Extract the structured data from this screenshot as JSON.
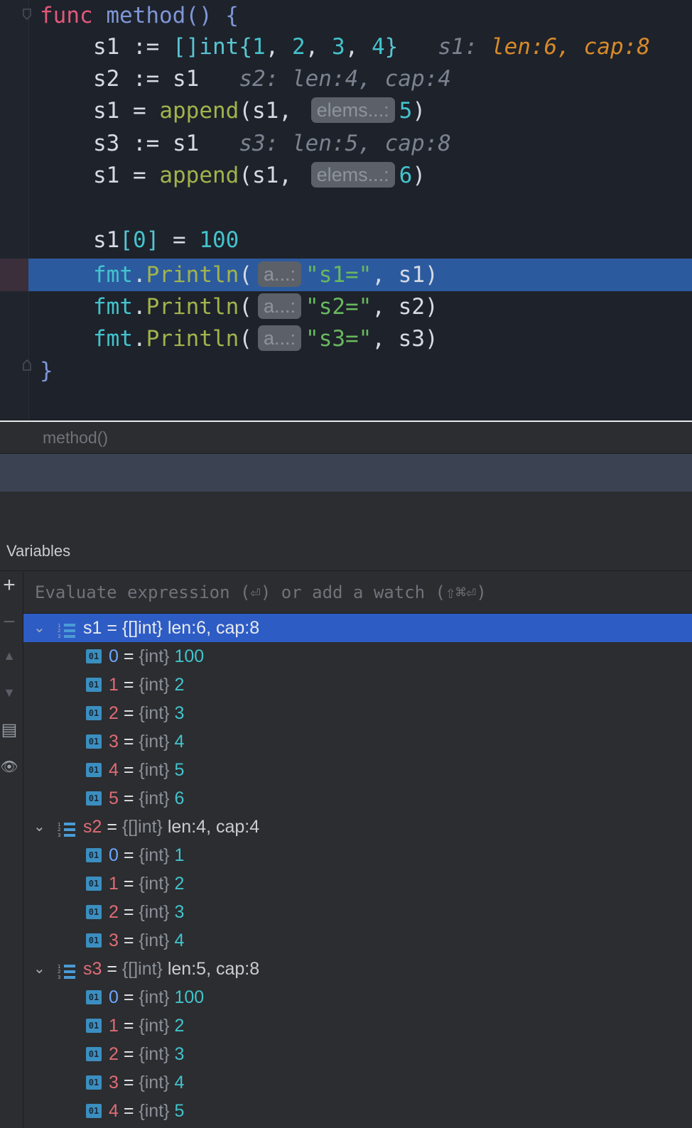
{
  "editor": {
    "lines": {
      "l1": {
        "kw": "func",
        "name": "method",
        "rest": "() {"
      },
      "l2": {
        "var": "s1",
        "op": " := ",
        "type": "[]int",
        "open": "{",
        "n1": "1",
        "n2": "2",
        "n3": "3",
        "n4": "4",
        "sep": ", ",
        "close": "}",
        "hint_name": "s1: ",
        "hint_val": "len:6, cap:8"
      },
      "l3": {
        "code": "s2 := s1",
        "hint": "s2: len:4, cap:4"
      },
      "l4": {
        "pre": "s1 = ",
        "call": "append",
        "args": "(s1, ",
        "chip": "elems...:",
        "num": "5",
        "close": ")"
      },
      "l5": {
        "code": "s3 := s1",
        "hint": "s3: len:5, cap:8"
      },
      "l6": {
        "pre": "s1 = ",
        "call": "append",
        "args": "(s1, ",
        "chip": "elems...:",
        "num": "6",
        "close": ")"
      },
      "l8": {
        "pre": "s1",
        "idx_open": "[",
        "idx": "0",
        "idx_close": "]",
        "mid": " = ",
        "num": "100"
      },
      "l9": {
        "pkg": "fmt",
        "dot": ".",
        "call": "Println",
        "open": "(",
        "chip": "a...:",
        "str": "\"s1=\"",
        "rest": ", s1)"
      },
      "l10": {
        "pkg": "fmt",
        "dot": ".",
        "call": "Println",
        "open": "(",
        "chip": "a...:",
        "str": "\"s2=\"",
        "rest": ", s2)"
      },
      "l11": {
        "pkg": "fmt",
        "dot": ".",
        "call": "Println",
        "open": "(",
        "chip": "a...:",
        "str": "\"s3=\"",
        "rest": ", s3)"
      },
      "l12": {
        "code": "}"
      }
    }
  },
  "breadcrumb": "method()",
  "panel": {
    "title": "Variables",
    "eval_placeholder": "Evaluate expression (⏎) or add a watch (⇧⌘⏎)",
    "tools": {
      "add": "+",
      "remove": "−",
      "up": "▲",
      "down": "▼",
      "copy": "▤",
      "watch": "👁"
    }
  },
  "variables": {
    "s1": {
      "name": "s1",
      "eq": " = ",
      "type": "{[]int}",
      "info": " len:6, cap:8",
      "items": [
        {
          "i": "0",
          "t": "{int}",
          "v": "100"
        },
        {
          "i": "1",
          "t": "{int}",
          "v": "2"
        },
        {
          "i": "2",
          "t": "{int}",
          "v": "3"
        },
        {
          "i": "3",
          "t": "{int}",
          "v": "4"
        },
        {
          "i": "4",
          "t": "{int}",
          "v": "5"
        },
        {
          "i": "5",
          "t": "{int}",
          "v": "6"
        }
      ]
    },
    "s2": {
      "name": "s2",
      "eq": " = ",
      "type": "{[]int}",
      "info": " len:4, cap:4",
      "items": [
        {
          "i": "0",
          "t": "{int}",
          "v": "1"
        },
        {
          "i": "1",
          "t": "{int}",
          "v": "2"
        },
        {
          "i": "2",
          "t": "{int}",
          "v": "3"
        },
        {
          "i": "3",
          "t": "{int}",
          "v": "4"
        }
      ]
    },
    "s3": {
      "name": "s3",
      "eq": " = ",
      "type": "{[]int}",
      "info": " len:5, cap:8",
      "items": [
        {
          "i": "0",
          "t": "{int}",
          "v": "100"
        },
        {
          "i": "1",
          "t": "{int}",
          "v": "2"
        },
        {
          "i": "2",
          "t": "{int}",
          "v": "3"
        },
        {
          "i": "3",
          "t": "{int}",
          "v": "4"
        },
        {
          "i": "4",
          "t": "{int}",
          "v": "5"
        }
      ]
    }
  },
  "element_icon_text": "01",
  "chevron": "⌄"
}
